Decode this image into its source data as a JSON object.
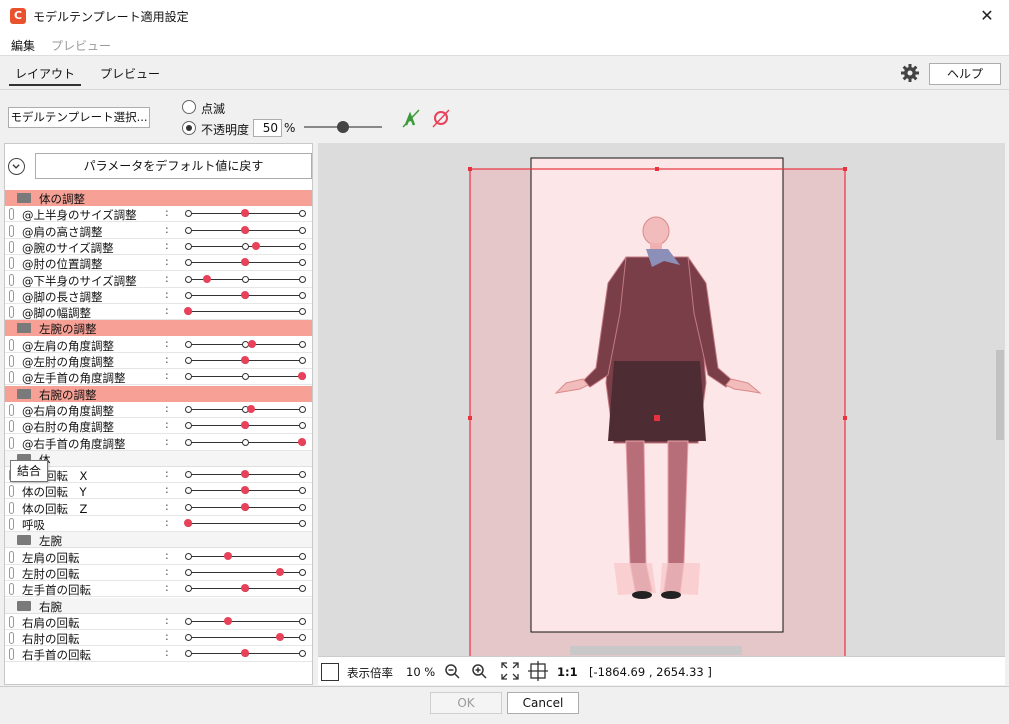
{
  "window": {
    "title": "モデルテンプレート適用設定",
    "close_glyph": "✕",
    "app_icon_letter": "C"
  },
  "menu": {
    "edit": "編集",
    "preview": "プレビュー"
  },
  "tabs": {
    "layout": "レイアウト",
    "preview": "プレビュー"
  },
  "toolbar": {
    "help": "ヘルプ",
    "template_select": "モデルテンプレート選択...",
    "blink": "点滅",
    "opacity_label": "不透明度",
    "opacity_value": "50",
    "opacity_unit": "%",
    "opacity_level_percent": 50
  },
  "panel": {
    "reset": "パラメータをデフォルト値に戻す",
    "tooltip": "結合"
  },
  "colors": {
    "accent": "#e8425a",
    "group_bg": "#f7a196",
    "frame_red": "#e8333f"
  },
  "params": [
    {
      "type": "group",
      "label": "体の調整",
      "style": "red"
    },
    {
      "label": "@上半身のサイズ調整",
      "marks": [
        0,
        0.5,
        1
      ],
      "value": 0.5
    },
    {
      "label": "@肩の高さ調整",
      "marks": [
        0,
        0.5,
        1
      ],
      "value": 0.5
    },
    {
      "label": "@腕のサイズ調整",
      "marks": [
        0,
        0.5,
        1
      ],
      "value": 0.6
    },
    {
      "label": "@肘の位置調整",
      "marks": [
        0,
        0.5,
        1
      ],
      "value": 0.5
    },
    {
      "label": "@下半身のサイズ調整",
      "marks": [
        0,
        0.5,
        1
      ],
      "value": 0.17
    },
    {
      "label": "@脚の長さ調整",
      "marks": [
        0,
        0.5,
        1
      ],
      "value": 0.5
    },
    {
      "label": "@脚の幅調整",
      "marks": [
        0,
        1
      ],
      "value": 0
    },
    {
      "type": "group",
      "label": "左腕の調整",
      "style": "red"
    },
    {
      "label": "@左肩の角度調整",
      "marks": [
        0,
        0.5,
        1
      ],
      "value": 0.56
    },
    {
      "label": "@左肘の角度調整",
      "marks": [
        0,
        0.5,
        1
      ],
      "value": 0.5
    },
    {
      "label": "@左手首の角度調整",
      "marks": [
        0,
        0.5,
        1
      ],
      "value": 1
    },
    {
      "type": "group",
      "label": "右腕の調整",
      "style": "red"
    },
    {
      "label": "@右肩の角度調整",
      "marks": [
        0,
        0.5,
        1
      ],
      "value": 0.55
    },
    {
      "label": "@右肘の角度調整",
      "marks": [
        0,
        0.5,
        1
      ],
      "value": 0.5
    },
    {
      "label": "@右手首の角度調整",
      "marks": [
        0,
        0.5,
        1
      ],
      "value": 1
    },
    {
      "type": "group",
      "label": "体",
      "style": "plain"
    },
    {
      "label": "体の回転　X",
      "marks": [
        0,
        0.5,
        1
      ],
      "value": 0.5
    },
    {
      "label": "体の回転　Y",
      "marks": [
        0,
        0.5,
        1
      ],
      "value": 0.5
    },
    {
      "label": "体の回転　Z",
      "marks": [
        0,
        0.5,
        1
      ],
      "value": 0.5
    },
    {
      "label": "呼吸",
      "marks": [
        0,
        1
      ],
      "value": 0
    },
    {
      "type": "group",
      "label": "左腕",
      "style": "plain"
    },
    {
      "label": "左肩の回転",
      "marks": [
        0,
        1
      ],
      "value": 0.35
    },
    {
      "label": "左肘の回転",
      "marks": [
        0,
        1
      ],
      "value": 0.81
    },
    {
      "label": "左手首の回転",
      "marks": [
        0,
        0.5,
        1
      ],
      "value": 0.5
    },
    {
      "type": "group",
      "label": "右腕",
      "style": "plain"
    },
    {
      "label": "右肩の回転",
      "marks": [
        0,
        1
      ],
      "value": 0.35
    },
    {
      "label": "右肘の回転",
      "marks": [
        0,
        1
      ],
      "value": 0.81
    },
    {
      "label": "右手首の回転",
      "marks": [
        0,
        0.5,
        1
      ],
      "value": 0.5
    }
  ],
  "status": {
    "zoom_label": "表示倍率",
    "zoom_value": "10 %",
    "one_to_one": "1:1",
    "coords": "[-1864.69 , 2654.33 ]"
  },
  "buttons": {
    "ok": "OK",
    "cancel": "Cancel"
  },
  "icons": {
    "gear": "gear-icon",
    "collapse": "chevron-down-circle-icon",
    "zoom_out": "zoom-out-icon",
    "zoom_in": "zoom-in-icon",
    "fit": "fit-screen-icon",
    "center": "crosshair-icon",
    "figure_on": "figure-link-icon",
    "figure_off": "figure-unlink-icon"
  }
}
